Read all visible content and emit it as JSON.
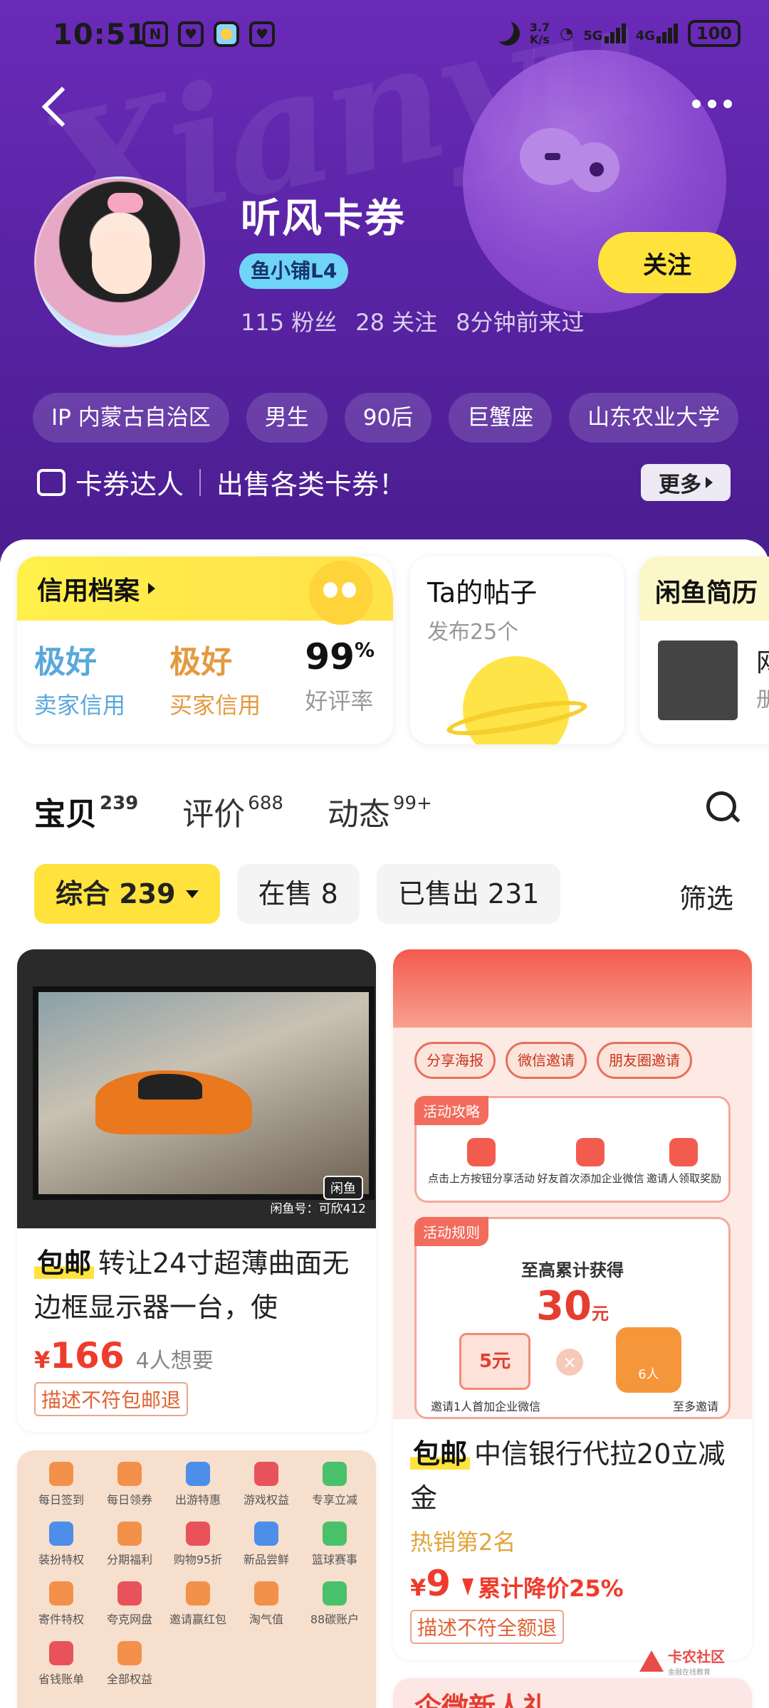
{
  "status_bar": {
    "time": "10:51",
    "net_speed_value": "3.7",
    "net_speed_unit": "K/s",
    "signal1": "5G",
    "signal2": "4G",
    "battery": "100"
  },
  "header": {
    "watermark": "Xianyu",
    "name": "听风卡券",
    "level_badge": "鱼小铺L4",
    "stats": [
      "115 粉丝",
      "28 关注",
      "8分钟前来过"
    ],
    "follow_label": "关注",
    "tags": [
      "IP 内蒙古自治区",
      "男生",
      "90后",
      "巨蟹座",
      "山东农业大学"
    ],
    "bio_role": "卡券达人",
    "bio_text": "出售各类卡券！",
    "more_label": "更多"
  },
  "credit": {
    "title": "信用档案",
    "seller_level": "极好",
    "seller_label": "卖家信用",
    "buyer_level": "极好",
    "buyer_label": "买家信用",
    "rate_value": "99",
    "rate_unit": "%",
    "rate_label": "好评率"
  },
  "posts": {
    "title": "Ta的帖子",
    "count_label": "发布25个"
  },
  "resume": {
    "title": "闲鱼简历",
    "text1": "网",
    "text2": "册"
  },
  "tabs": [
    {
      "label": "宝贝",
      "count": "239"
    },
    {
      "label": "评价",
      "count": "688"
    },
    {
      "label": "动态",
      "count": "99+"
    }
  ],
  "filters": {
    "all": "综合 239",
    "on_sale": "在售 8",
    "sold": "已售出 231",
    "filter_label": "筛选"
  },
  "products": [
    {
      "badge": "包邮",
      "title": "转让24寸超薄曲面无边框显示器一台，使",
      "price_symbol": "¥",
      "price": "166",
      "wants": "4人想要",
      "tag": "描述不符包邮退",
      "image_logo": "闲鱼",
      "image_watermark": "闲鱼号：可欣412"
    },
    {
      "badge": "包邮",
      "title": "中信银行代拉20立减金",
      "hot": "热销第2名",
      "price_symbol": "¥",
      "price": "9",
      "drop": "累计降价25%",
      "tag": "描述不符全额退",
      "promo": {
        "buttons": [
          "分享海报",
          "微信邀请",
          "朋友圈邀请"
        ],
        "guide_label": "活动攻略",
        "steps": [
          "点击上方按钮分享活动",
          "好友首次添加企业微信",
          "邀请人领取奖励"
        ],
        "rules_label": "活动规则",
        "max_text": "至高累计获得",
        "amount": "30",
        "amount_unit": "元",
        "coupon": "5元",
        "times": "×",
        "people": "6人",
        "cap1": "邀请1人首加企业微信",
        "cap2": "至多邀请"
      }
    }
  ],
  "product3_grid": [
    "每日签到",
    "每日领券",
    "出游特惠",
    "游戏权益",
    "专享立减",
    "装扮特权",
    "分期福利",
    "购物95折",
    "新品尝鲜",
    "篮球赛事",
    "寄件特权",
    "夸克网盘",
    "邀请赢红包",
    "淘气值",
    "88碳账户",
    "省钱账单",
    "全部权益"
  ],
  "product4_title": "企微新人礼",
  "community": {
    "name": "卡农社区",
    "slogan": "金融在线教育"
  }
}
